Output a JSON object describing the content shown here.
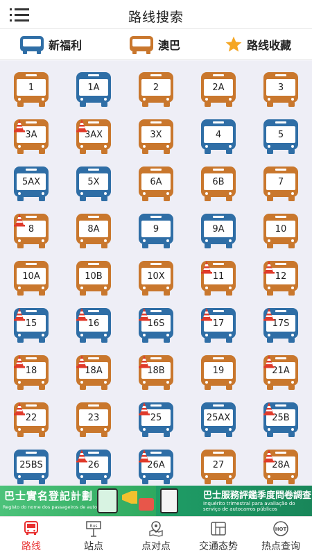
{
  "header": {
    "title": "路线搜索",
    "menu_icon": "menu-icon"
  },
  "legend": {
    "items": [
      {
        "label": "新福利",
        "icon": "bus-icon",
        "color": "#2f6ea6"
      },
      {
        "label": "澳巴",
        "icon": "bus-icon",
        "color": "#c9772d"
      },
      {
        "label": "路线收藏",
        "icon": "star-icon",
        "color": "#f5a623"
      }
    ]
  },
  "colors": {
    "blue": "#2f6ea6",
    "orange": "#c9772d",
    "cone": "#e03a2a",
    "active": "#e83030"
  },
  "routes": [
    {
      "num": "1",
      "operator": "orange",
      "cone": false
    },
    {
      "num": "1A",
      "operator": "blue",
      "cone": false
    },
    {
      "num": "2",
      "operator": "orange",
      "cone": false
    },
    {
      "num": "2A",
      "operator": "orange",
      "cone": false
    },
    {
      "num": "3",
      "operator": "orange",
      "cone": false
    },
    {
      "num": "3A",
      "operator": "orange",
      "cone": true
    },
    {
      "num": "3AX",
      "operator": "orange",
      "cone": true
    },
    {
      "num": "3X",
      "operator": "orange",
      "cone": false
    },
    {
      "num": "4",
      "operator": "blue",
      "cone": false
    },
    {
      "num": "5",
      "operator": "blue",
      "cone": false
    },
    {
      "num": "5AX",
      "operator": "blue",
      "cone": false
    },
    {
      "num": "5X",
      "operator": "blue",
      "cone": false
    },
    {
      "num": "6A",
      "operator": "orange",
      "cone": false
    },
    {
      "num": "6B",
      "operator": "orange",
      "cone": false
    },
    {
      "num": "7",
      "operator": "orange",
      "cone": false
    },
    {
      "num": "8",
      "operator": "orange",
      "cone": true
    },
    {
      "num": "8A",
      "operator": "orange",
      "cone": false
    },
    {
      "num": "9",
      "operator": "blue",
      "cone": false
    },
    {
      "num": "9A",
      "operator": "blue",
      "cone": false
    },
    {
      "num": "10",
      "operator": "orange",
      "cone": false
    },
    {
      "num": "10A",
      "operator": "orange",
      "cone": false
    },
    {
      "num": "10B",
      "operator": "orange",
      "cone": false
    },
    {
      "num": "10X",
      "operator": "orange",
      "cone": false
    },
    {
      "num": "11",
      "operator": "orange",
      "cone": true
    },
    {
      "num": "12",
      "operator": "orange",
      "cone": true
    },
    {
      "num": "15",
      "operator": "blue",
      "cone": true
    },
    {
      "num": "16",
      "operator": "blue",
      "cone": true
    },
    {
      "num": "16S",
      "operator": "blue",
      "cone": true
    },
    {
      "num": "17",
      "operator": "blue",
      "cone": true
    },
    {
      "num": "17S",
      "operator": "blue",
      "cone": true
    },
    {
      "num": "18",
      "operator": "orange",
      "cone": true
    },
    {
      "num": "18A",
      "operator": "orange",
      "cone": true
    },
    {
      "num": "18B",
      "operator": "orange",
      "cone": true
    },
    {
      "num": "19",
      "operator": "orange",
      "cone": false
    },
    {
      "num": "21A",
      "operator": "orange",
      "cone": true
    },
    {
      "num": "22",
      "operator": "orange",
      "cone": true
    },
    {
      "num": "23",
      "operator": "orange",
      "cone": false
    },
    {
      "num": "25",
      "operator": "blue",
      "cone": true
    },
    {
      "num": "25AX",
      "operator": "blue",
      "cone": false
    },
    {
      "num": "25B",
      "operator": "blue",
      "cone": true
    },
    {
      "num": "25BS",
      "operator": "blue",
      "cone": false
    },
    {
      "num": "26",
      "operator": "blue",
      "cone": true
    },
    {
      "num": "26A",
      "operator": "blue",
      "cone": true
    },
    {
      "num": "27",
      "operator": "orange",
      "cone": false
    },
    {
      "num": "28A",
      "operator": "orange",
      "cone": true
    }
  ],
  "banner": {
    "left_title": "巴士實名登記計劃",
    "left_subtitle": "Registo do nome dos passageiros de autocarros",
    "right_title": "巴士服務評鑑季度問卷調查",
    "right_subtitle": "Inquérito trimestral para avaliação do serviço de autocarros públicos"
  },
  "tabs": [
    {
      "label": "路线",
      "icon": "bus-route-icon",
      "active": true
    },
    {
      "label": "站点",
      "icon": "bus-stop-icon",
      "active": false
    },
    {
      "label": "点对点",
      "icon": "map-point-icon",
      "active": false
    },
    {
      "label": "交通态势",
      "icon": "traffic-icon",
      "active": false
    },
    {
      "label": "热点查询",
      "icon": "hot-icon",
      "active": false
    }
  ]
}
